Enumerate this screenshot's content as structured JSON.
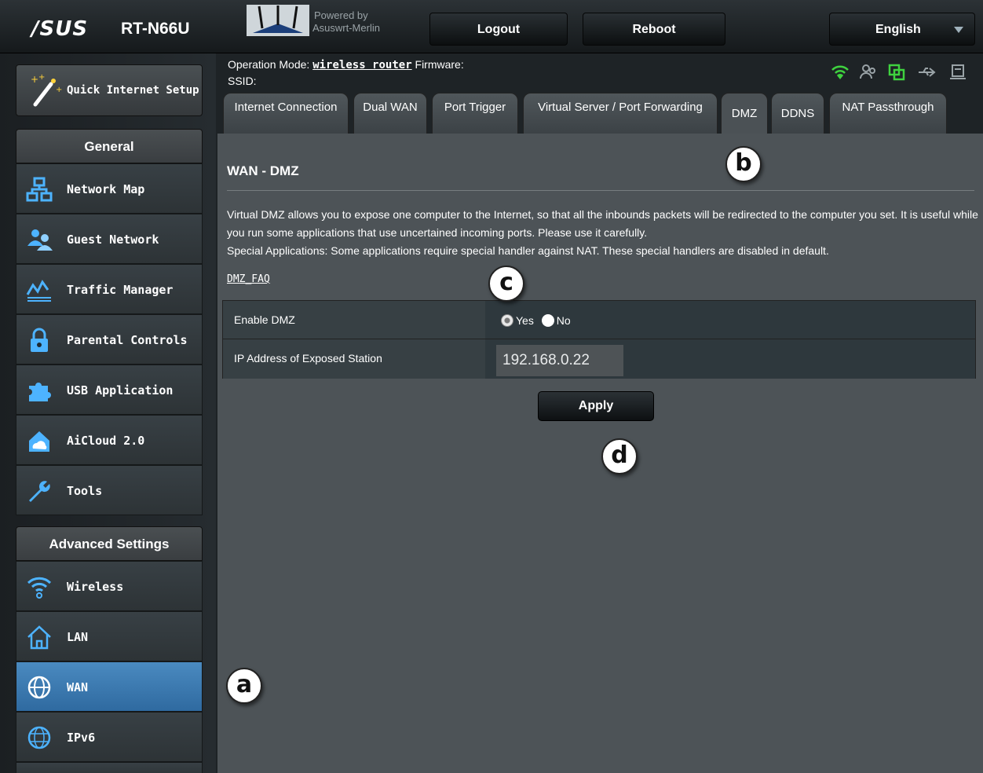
{
  "header": {
    "brand": "/SUS",
    "model": "RT-N66U",
    "powered_by": "Powered by",
    "firmware_name": "Asuswrt-Merlin",
    "logout_label": "Logout",
    "reboot_label": "Reboot",
    "language": "English"
  },
  "status": {
    "operation_mode_label": "Operation Mode:",
    "operation_mode": "wireless router",
    "firmware_label": "Firmware:",
    "ssid_label": "SSID:",
    "icons": [
      "wifi-icon",
      "users-icon",
      "copy-icon",
      "usb-icon",
      "printer-icon"
    ],
    "wifi_color": "#3fd23f",
    "copy_color": "#3fd23f"
  },
  "sidebar": {
    "quick_setup": "Quick Internet Setup",
    "general_title": "General",
    "general_items": [
      {
        "label": "Network Map",
        "icon": "network-map-icon"
      },
      {
        "label": "Guest Network",
        "icon": "guest-network-icon"
      },
      {
        "label": "Traffic Manager",
        "icon": "traffic-manager-icon"
      },
      {
        "label": "Parental Controls",
        "icon": "lock-icon"
      },
      {
        "label": "USB Application",
        "icon": "puzzle-icon"
      },
      {
        "label": "AiCloud 2.0",
        "icon": "cloud-home-icon"
      },
      {
        "label": "Tools",
        "icon": "wrench-icon"
      }
    ],
    "advanced_title": "Advanced Settings",
    "advanced_items": [
      {
        "label": "Wireless",
        "icon": "wifi-icon"
      },
      {
        "label": "LAN",
        "icon": "house-icon"
      },
      {
        "label": "WAN",
        "icon": "globe-icon",
        "active": true
      },
      {
        "label": "IPv6",
        "icon": "ipv6-globe-icon"
      }
    ],
    "active_color": "#3d7ab4"
  },
  "tabs": [
    {
      "label": "Internet Connection"
    },
    {
      "label": "Dual WAN"
    },
    {
      "label": "Port Trigger"
    },
    {
      "label": "Virtual Server / Port Forwarding"
    },
    {
      "label": "DMZ",
      "active": true
    },
    {
      "label": "DDNS"
    },
    {
      "label": "NAT Passthrough"
    }
  ],
  "panel": {
    "title": "WAN - DMZ",
    "description_1": "Virtual DMZ allows you to expose one computer to the Internet, so that all the inbounds packets will be redirected to the computer you set. It is useful while you run some applications that use uncertained incoming ports. Please use it carefully.",
    "description_2": "Special Applications: Some applications require special handler against NAT. These special handlers are disabled in default.",
    "faq_link": "DMZ_FAQ",
    "enable_label": "Enable DMZ",
    "yes_label": "Yes",
    "no_label": "No",
    "enable_value": "Yes",
    "ip_label": "IP Address of Exposed Station",
    "ip_value": "192.168.0.22",
    "apply_label": "Apply"
  },
  "callouts": [
    "a",
    "b",
    "c",
    "d"
  ]
}
